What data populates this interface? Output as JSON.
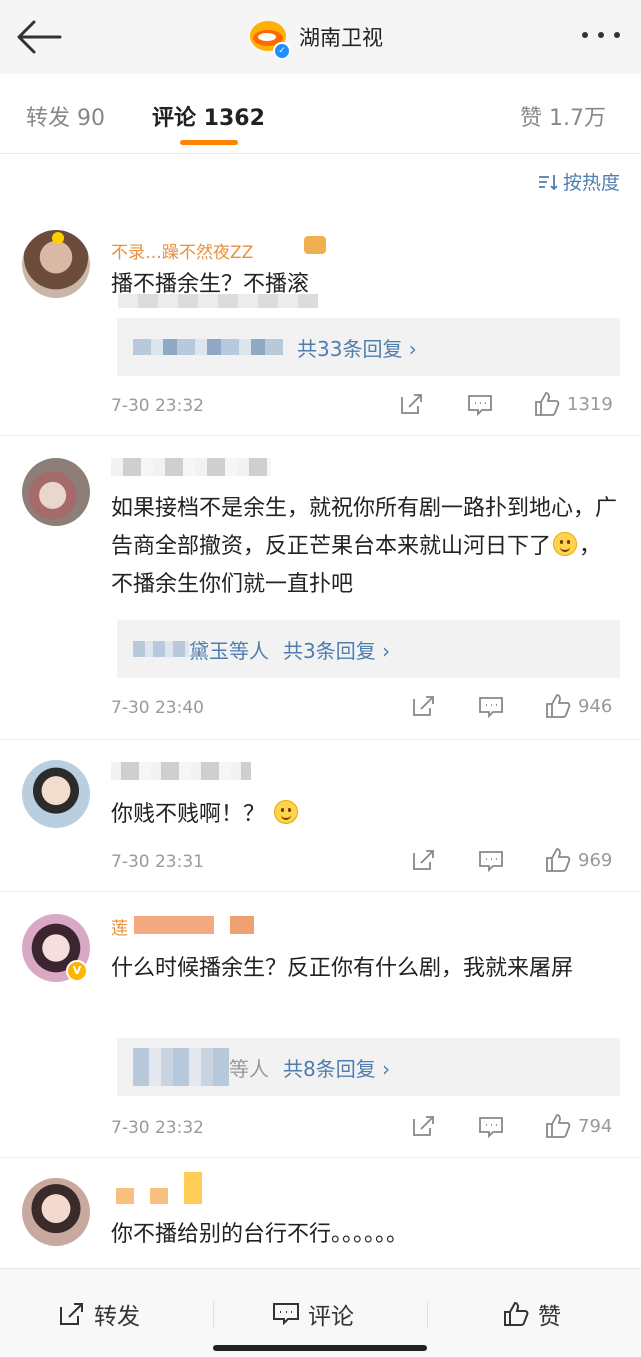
{
  "header": {
    "title": "湖南卫视",
    "back_icon": "back-arrow-icon",
    "more_icon": "more-dots-icon"
  },
  "tabs": [
    {
      "label": "转发 90"
    },
    {
      "label": "评论 1362"
    },
    {
      "label": "赞 1.7万"
    }
  ],
  "accent_color": "#ff8200",
  "link_color": "#507daf",
  "sort": {
    "label": "按热度"
  },
  "comments": [
    {
      "name": "不录…躁不然夜ZZ",
      "text": "播不播余生？不播滚",
      "reply_who": "",
      "reply_count": "共33条回复 ›",
      "time": "7-30 23:32",
      "likes": "1319"
    },
    {
      "name": "",
      "text": "如果接档不是余生，就祝你所有剧一路扑到地心，广告商全部撤资，反正芒果台本来就山河日下了",
      "text_tail": "，不播余生你们就一直扑吧",
      "reply_who": "黛玉等人",
      "reply_count": "共3条回复 ›",
      "time": "7-30 23:40",
      "likes": "946"
    },
    {
      "name": "",
      "text": "你贱不贱啊！？",
      "time": "7-30 23:31",
      "likes": "969"
    },
    {
      "name": "莲",
      "text": "什么时候播余生？反正你有什么剧，我就来屠屏",
      "reply_who": "等人",
      "reply_count": "共8条回复 ›",
      "time": "7-30 23:32",
      "likes": "794"
    },
    {
      "name": "",
      "text": "你不播给别的台行不行。。。。。。"
    }
  ],
  "bottom": {
    "repost": "转发",
    "comment": "评论",
    "like": "赞"
  }
}
